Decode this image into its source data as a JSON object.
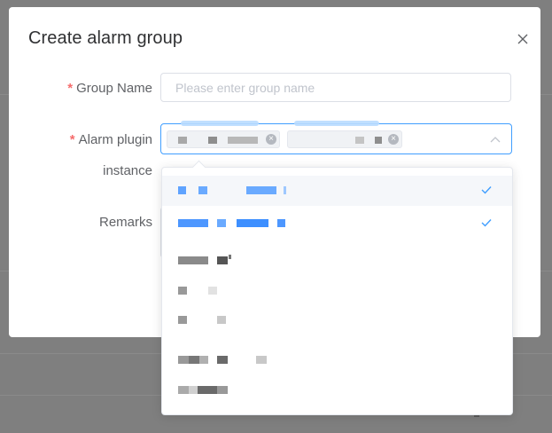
{
  "dialog": {
    "title": "Create alarm group",
    "close_icon": "close-icon"
  },
  "form": {
    "group_name": {
      "required_mark": "*",
      "label": "Group Name",
      "value": "",
      "placeholder": "Please enter group name"
    },
    "alarm_plugin": {
      "required_mark": "*",
      "label_line1": "Alarm plugin",
      "label_line2": "instance",
      "selected_count": 2
    },
    "remarks": {
      "label": "Remarks"
    }
  },
  "dropdown": {
    "options": [
      {
        "selected": true
      },
      {
        "selected": true
      },
      {
        "selected": false
      },
      {
        "selected": false
      },
      {
        "selected": false
      },
      {
        "selected": false
      },
      {
        "selected": false
      }
    ]
  },
  "colors": {
    "accent": "#409eff",
    "required": "#f56c6c",
    "label": "#606266",
    "placeholder": "#c0c4cc",
    "overlay": "#7f7f7f"
  }
}
